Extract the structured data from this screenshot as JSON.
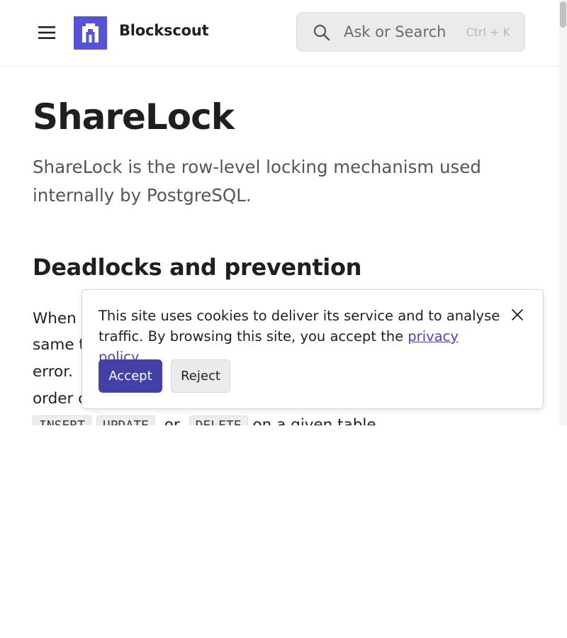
{
  "header": {
    "site_name": "Blockscout",
    "menu_icon": "hamburger-menu-icon",
    "logo_icon": "blockscout-logo-icon",
    "logo_color": "#5653d4"
  },
  "search": {
    "placeholder": "Ask or Search",
    "shortcut": "Ctrl + K",
    "icon": "search-icon"
  },
  "main": {
    "title": "ShareLock",
    "intro": "ShareLock is the row-level locking mechanism used internally by PostgreSQL.",
    "section_heading": "Deadlocks and prevention",
    "paragraph_lines": [
      "When s",
      "same t",
      "error.",
      "order c"
    ],
    "paragraph_tail_fragment": "g",
    "code_terms": [
      "INSERT",
      "UPDATE",
      "DELETE"
    ],
    "code_connector": "or",
    "code_tail": "on a given table."
  },
  "cookie_banner": {
    "text_before_link": "This site uses cookies to deliver its service and to analyse traffic. By browsing this site, you accept the ",
    "link_text": "privacy policy",
    "text_after_link": ".",
    "accept_label": "Accept",
    "reject_label": "Reject",
    "close_icon": "close-icon",
    "accept_color": "#4340a8",
    "link_color": "#4a44b7"
  }
}
